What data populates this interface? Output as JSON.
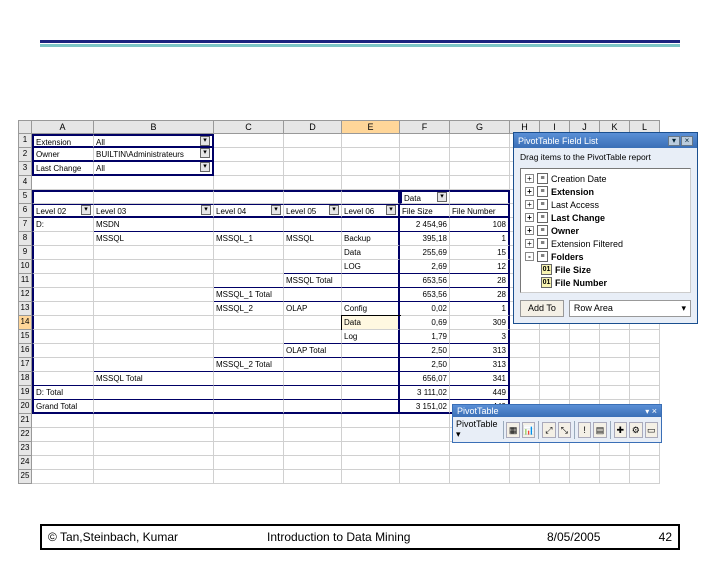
{
  "columns": [
    "A",
    "B",
    "C",
    "D",
    "E",
    "F",
    "G",
    "H",
    "I",
    "J",
    "K",
    "L"
  ],
  "filters": {
    "r1": {
      "label": "Extension",
      "value": "All"
    },
    "r2": {
      "label": "Owner",
      "value": "BUILTIN\\Administrateurs"
    },
    "r3": {
      "label": "Last Change",
      "value": "All"
    }
  },
  "headers": {
    "data": "Data",
    "level02": "Level 02",
    "level03": "Level 03",
    "level04": "Level 04",
    "level05": "Level 05",
    "level06": "Level 06",
    "filesize": "File Size",
    "filenum": "File Number"
  },
  "rows": {
    "r7": {
      "a": "D:",
      "b": "MSDN",
      "f": "2 454,96",
      "g": "108"
    },
    "r8": {
      "b": "MSSQL",
      "c": "MSSQL_1",
      "d": "MSSQL",
      "e": "Backup",
      "f": "395,18",
      "g": "1"
    },
    "r9": {
      "e": "Data",
      "f": "255,69",
      "g": "15"
    },
    "r10": {
      "e": "LOG",
      "f": "2,69",
      "g": "12"
    },
    "r11": {
      "d": "MSSQL Total",
      "f": "653,56",
      "g": "28"
    },
    "r12": {
      "c": "MSSQL_1 Total",
      "f": "653,56",
      "g": "28"
    },
    "r13": {
      "c": "MSSQL_2",
      "d": "OLAP",
      "e": "Config",
      "f": "0,02",
      "g": "1"
    },
    "r14": {
      "e": "Data",
      "f": "0,69",
      "g": "309"
    },
    "r15": {
      "e": "Log",
      "f": "1,79",
      "g": "3"
    },
    "r16": {
      "d": "OLAP Total",
      "f": "2,50",
      "g": "313"
    },
    "r17": {
      "c": "MSSQL_2 Total",
      "f": "2,50",
      "g": "313"
    },
    "r18": {
      "b": "MSSQL Total",
      "f": "656,07",
      "g": "341"
    },
    "r19": {
      "a": "D: Total",
      "f": "3 111,02",
      "g": "449"
    },
    "r20": {
      "a": "Grand Total",
      "f": "3 151,02",
      "g": "449"
    }
  },
  "fieldlist": {
    "title": "PivotTable Field List",
    "hint": "Drag items to the PivotTable report",
    "items": [
      {
        "label": "Creation Date",
        "exp": "+",
        "bold": false
      },
      {
        "label": "Extension",
        "exp": "+",
        "bold": true
      },
      {
        "label": "Last Access",
        "exp": "+",
        "bold": false
      },
      {
        "label": "Last Change",
        "exp": "+",
        "bold": true
      },
      {
        "label": "Owner",
        "exp": "+",
        "bold": true
      },
      {
        "label": "Extension Filtered",
        "exp": "+",
        "bold": false
      },
      {
        "label": "Folders",
        "exp": "-",
        "bold": true
      }
    ],
    "children": [
      {
        "label": "File Size"
      },
      {
        "label": "File Number"
      }
    ],
    "addto": "Add To",
    "area": "Row Area"
  },
  "pvtoolbar": {
    "title": "PivotTable",
    "btn": "PivotTable"
  },
  "footer": {
    "copyright": "© Tan,Steinbach, Kumar",
    "title": "Introduction to Data Mining",
    "date": "8/05/2005",
    "page": "42"
  }
}
